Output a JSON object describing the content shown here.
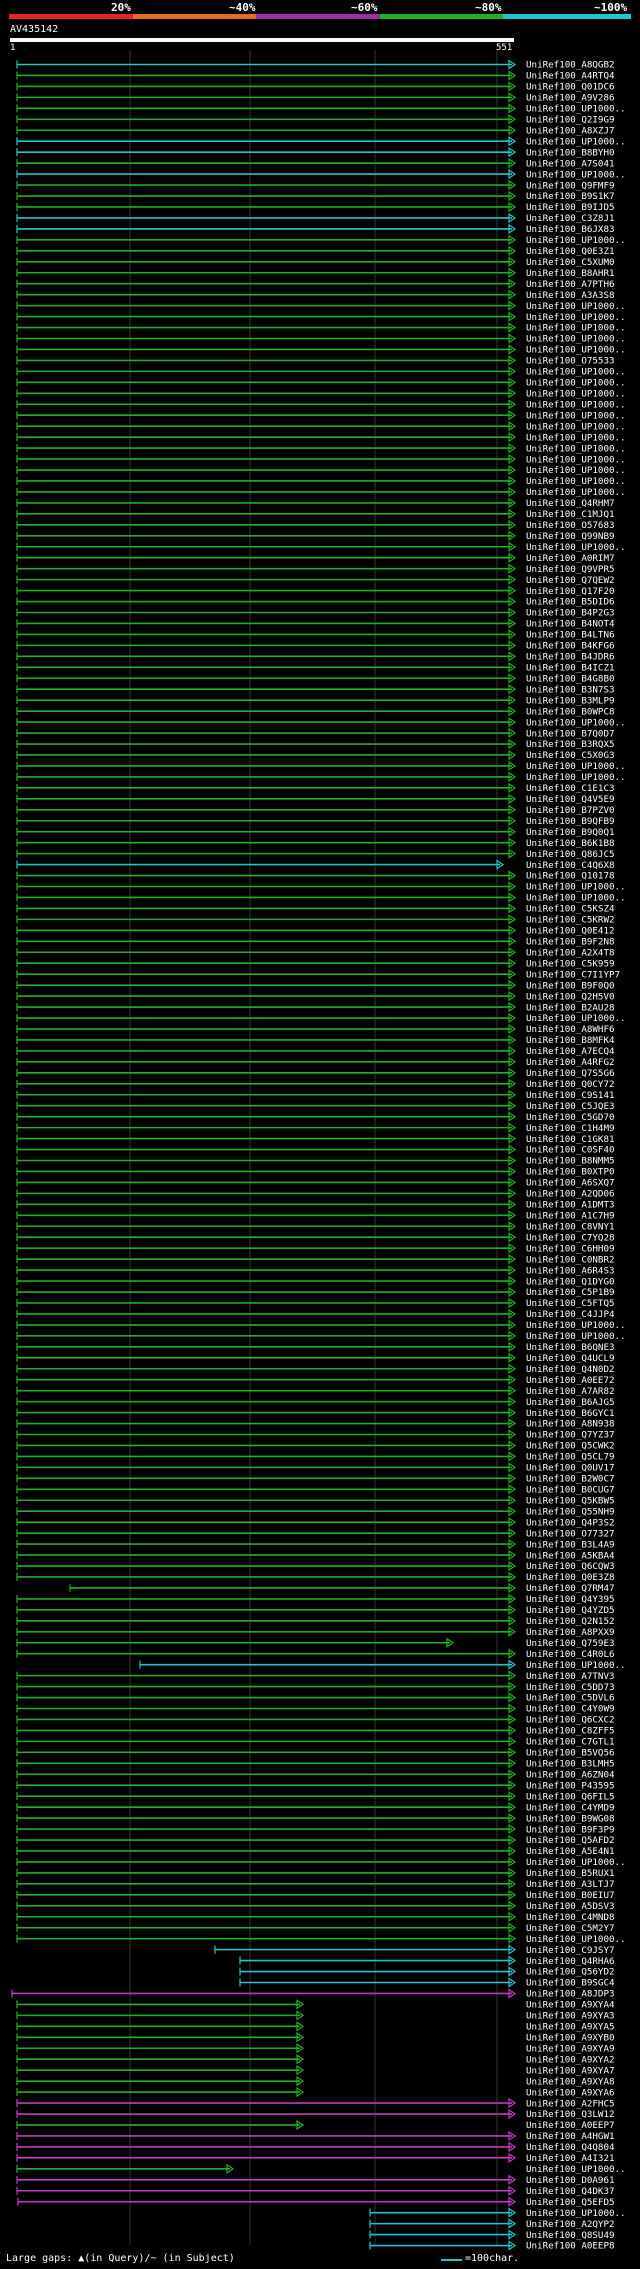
{
  "legend": {
    "labels": [
      "20%",
      "~40%",
      "~60%",
      "~80%",
      "~100%"
    ],
    "colors": [
      "#e8212b",
      "#e86a1c",
      "#9b2ea1",
      "#22b022",
      "#23c6c9"
    ]
  },
  "query": {
    "id": "AV435142",
    "length": 551,
    "ruler_start": "1",
    "ruler_end": "551"
  },
  "footer": {
    "gaps_text": "Large gaps: ▲(in Query)/~ (in Subject)",
    "scale_text": "=100char."
  },
  "hits": [
    "UniRef100_A8QGB2",
    "UniRef100_A4RTQ4",
    "UniRef100_Q01DC6",
    "UniRef100_A9V286",
    "UniRef100_UP1000..",
    "UniRef100_Q2I9G9",
    "UniRef100_A8XZJ7",
    "UniRef100_UP1000..",
    "UniRef100_B8BYH0",
    "UniRef100_A7S041",
    "UniRef100_UP1000..",
    "UniRef100_Q9FMF9",
    "UniRef100_B9S1K7",
    "UniRef100_B9IJD5",
    "UniRef100_C3Z8J1",
    "UniRef100_B6JX83",
    "UniRef100_UP1000..",
    "UniRef100_Q0E3Z1",
    "UniRef100_C5XUM0",
    "UniRef100_B8AHR1",
    "UniRef100_A7PTH6",
    "UniRef100_A3A3S8",
    "UniRef100_UP1000..",
    "UniRef100_UP1000..",
    "UniRef100_UP1000..",
    "UniRef100_UP1000..",
    "UniRef100_UP1000..",
    "UniRef100_O75533",
    "UniRef100_UP1000..",
    "UniRef100_UP1000..",
    "UniRef100_UP1000..",
    "UniRef100_UP1000..",
    "UniRef100_UP1000..",
    "UniRef100_UP1000..",
    "UniRef100_UP1000..",
    "UniRef100_UP1000..",
    "UniRef100_UP1000..",
    "UniRef100_UP1000..",
    "UniRef100_UP1000..",
    "UniRef100_UP1000..",
    "UniRef100_Q4RHM7",
    "UniRef100_C1MJQ1",
    "UniRef100_O57683",
    "UniRef100_Q99NB9",
    "UniRef100_UP1000..",
    "UniRef100_A0RIM7",
    "UniRef100_Q9VPR5",
    "UniRef100_Q7QEW2",
    "UniRef100_Q17F20",
    "UniRef100_B5DID6",
    "UniRef100_B4P2G3",
    "UniRef100_B4NOT4",
    "UniRef100_B4LTN6",
    "UniRef100_B4KFG6",
    "UniRef100_B4JDR6",
    "UniRef100_B4ICZ1",
    "UniRef100_B4G8B0",
    "UniRef100_B3N7S3",
    "UniRef100_B3MLP9",
    "UniRef100_B0WPC8",
    "UniRef100_UP1000..",
    "UniRef100_B7Q0D7",
    "UniRef100_B3RQX5",
    "UniRef100_C5X0G3",
    "UniRef100_UP1000..",
    "UniRef100_UP1000..",
    "UniRef100_C1E1C3",
    "UniRef100_Q4V5E9",
    "UniRef100_B7PZV0",
    "UniRef100_B9QFB9",
    "UniRef100_B9Q0Q1",
    "UniRef100_B6K1B8",
    "UniRef100_Q86JC5",
    "UniRef100_C4Q6X8",
    "UniRef100_Q10178",
    "UniRef100_UP1000..",
    "UniRef100_UP1000..",
    "UniRef100_C5KSZ4",
    "UniRef100_C5KRW2",
    "UniRef100_Q0E412",
    "UniRef100_B9F2N8",
    "UniRef100_A2X4T8",
    "UniRef100_C5K959",
    "UniRef100_C7I1YP7",
    "UniRef100_B9F0Q0",
    "UniRef100_Q2H5V0",
    "UniRef100_B2AU28",
    "UniRef100_UP1000..",
    "UniRef100_A8WHF6",
    "UniRef100_B8MFK4",
    "UniRef100_A7ECQ4",
    "UniRef100_A4RFG2",
    "UniRef100_Q7S5G6",
    "UniRef100_Q0CY72",
    "UniRef100_C9S141",
    "UniRef100_C5JQE3",
    "UniRef100_C5GD70",
    "UniRef100_C1H4M9",
    "UniRef100_C1GK81",
    "UniRef100_C0SF40",
    "UniRef100_B8NMM5",
    "UniRef100_B0XTP0",
    "UniRef100_A6SXQ7",
    "UniRef100_A2QD06",
    "UniRef100_A1DMT3",
    "UniRef100_A1C7H9",
    "UniRef100_C8VNY1",
    "UniRef100_C7YQ28",
    "UniRef100_C6HH09",
    "UniRef100_C0NBR2",
    "UniRef100_A6R4S3",
    "UniRef100_Q1DYG0",
    "UniRef100_C5P1B9",
    "UniRef100_C5FTQ5",
    "UniRef100_C4JJP4",
    "UniRef100_UP1000..",
    "UniRef100_UP1000..",
    "UniRef100_B6QNE3",
    "UniRef100_Q4UCL9",
    "UniRef100_Q4N0D2",
    "UniRef100_A0EE72",
    "UniRef100_A7AR82",
    "UniRef100_B6AJG5",
    "UniRef100_B6GYC1",
    "UniRef100_A8N938",
    "UniRef100_Q7YZ37",
    "UniRef100_Q5CWK2",
    "UniRef100_Q5CL79",
    "UniRef100_Q0UV17",
    "UniRef100_B2W0C7",
    "UniRef100_B0CUG7",
    "UniRef100_Q5KBW5",
    "UniRef100_Q55NH9",
    "UniRef100_Q4P3S2",
    "UniRef100_O77327",
    "UniRef100_B3L4A9",
    "UniRef100_A5KBA4",
    "UniRef100_Q6CQW3",
    "UniRef100_Q0E3Z8",
    "UniRef100_Q7RM47",
    "UniRef100_Q4Y395",
    "UniRef100_Q4YZD5",
    "UniRef100_Q2N152",
    "UniRef100_A8PXX9",
    "UniRef100_Q759E3",
    "UniRef100_C4R0L6",
    "UniRef100_UP1000..",
    "UniRef100_A7TNV3",
    "UniRef100_C5DD73",
    "UniRef100_C5DVL6",
    "UniRef100_C4Y0W9",
    "UniRef100_Q6CXC2",
    "UniRef100_C8ZFF5",
    "UniRef100_C7GTL1",
    "UniRef100_B5VQ56",
    "UniRef100_B3LMH5",
    "UniRef100_A6ZN04",
    "UniRef100_P43595",
    "UniRef100_Q6FIL5",
    "UniRef100_C4YMD9",
    "UniRef100_B9WG08",
    "UniRef100_B9F3P9",
    "UniRef100_Q5AFD2",
    "UniRef100_A5E4N1",
    "UniRef100_UP1000..",
    "UniRef100_B5RUX1",
    "UniRef100_A3LTJ7",
    "UniRef100_B0EIU7",
    "UniRef100_A5DSV3",
    "UniRef100_C4MND8",
    "UniRef100_C5M2Y7",
    "UniRef100_UP1000..",
    "UniRef100_C9JSY7",
    "UniRef100_Q4RHA6",
    "UniRef100_Q56YD2",
    "UniRef100_B9SGC4",
    "UniRef100_A8JDP3",
    "UniRef100_A9XYA4",
    "UniRef100_A9XYA3",
    "UniRef100_A9XYA5",
    "UniRef100_A9XYB0",
    "UniRef100_A9XYA9",
    "UniRef100_A9XYA2",
    "UniRef100_A9XYA7",
    "UniRef100_A9XYA8",
    "UniRef100_A9XYA6",
    "UniRef100_A2FHC5",
    "UniRef100_Q3LW12",
    "UniRef100_A0EEP7",
    "UniRef100_A4HGW1",
    "UniRef100_Q4Q804",
    "UniRef100_A4I321",
    "UniRef100_UP1000..",
    "UniRef100_D0A961",
    "UniRef100_Q4DK37",
    "UniRef100_Q5EFD5",
    "UniRef100_UP1000..",
    "UniRef100_A2QYP2",
    "UniRef100_Q8SU49",
    "UniRef100_A0EEP8"
  ]
}
